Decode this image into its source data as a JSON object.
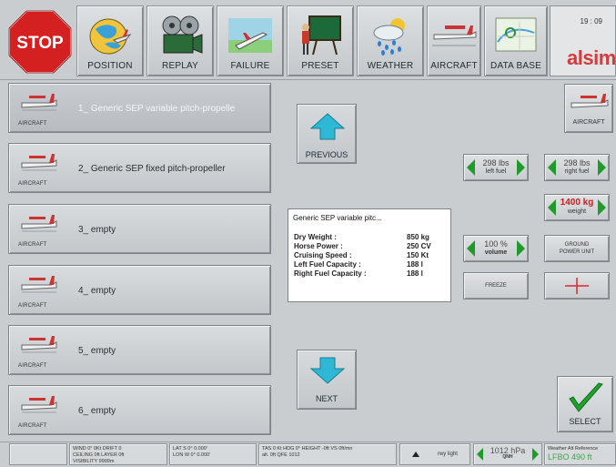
{
  "toolbar": {
    "stop_label": "STOP",
    "buttons": [
      {
        "label": "POSITION",
        "icon": "globe-plane-icon"
      },
      {
        "label": "REPLAY",
        "icon": "film-reel-icon"
      },
      {
        "label": "FAILURE",
        "icon": "crashed-plane-icon"
      },
      {
        "label": "PRESET",
        "icon": "chalkboard-instructor-icon"
      },
      {
        "label": "WEATHER",
        "icon": "rain-cloud-icon"
      },
      {
        "label": "AIRCRAFT",
        "icon": "aircraft-icon"
      },
      {
        "label": "DATA BASE",
        "icon": "map-database-icon"
      }
    ],
    "time": "19 : 09",
    "brand": "alsim"
  },
  "aircraft_list": [
    {
      "number": "1_",
      "name": "Generic SEP variable pitch-propelle",
      "sub": "AIRCRAFT",
      "selected": true
    },
    {
      "number": "2_",
      "name": "Generic SEP fixed pitch-propeller",
      "sub": "AIRCRAFT",
      "selected": false
    },
    {
      "number": "3_",
      "name": "empty",
      "sub": "AIRCRAFT",
      "selected": false
    },
    {
      "number": "4_",
      "name": "empty",
      "sub": "AIRCRAFT",
      "selected": false
    },
    {
      "number": "5_",
      "name": "empty",
      "sub": "AIRCRAFT",
      "selected": false
    },
    {
      "number": "6_",
      "name": "empty",
      "sub": "AIRCRAFT",
      "selected": false
    }
  ],
  "nav": {
    "previous": "PREVIOUS",
    "next": "NEXT"
  },
  "info": {
    "title": "Generic SEP variable pitc...",
    "rows": [
      {
        "label": "Dry Weight :",
        "value": "850 kg"
      },
      {
        "label": "Horse Power :",
        "value": "250 CV"
      },
      {
        "label": "Cruising Speed :",
        "value": "150 Kt"
      },
      {
        "label": "Left Fuel Capacity :",
        "value": "188 l"
      },
      {
        "label": "Right Fuel Capacity :",
        "value": "188 l"
      }
    ]
  },
  "right_panel": {
    "aircraft_label": "AIRCRAFT",
    "left_fuel": {
      "value": "298 lbs",
      "sub": "left fuel"
    },
    "right_fuel": {
      "value": "298 lbs",
      "sub": "right fuel"
    },
    "weight": {
      "value": "1400 kg",
      "sub": "weight"
    },
    "volume": {
      "value": "100 %",
      "sub": "volume"
    },
    "ground_power": "GROUND POWER UNIT",
    "freeze": "FREEZE",
    "select": "SELECT"
  },
  "status_bar": {
    "wind": [
      "WIND 0° 0Kt  DRIFT 0",
      "CEILING 0ft  LAYER 0ft",
      "VISIBILITY 9999m"
    ],
    "pos": [
      "LAT  S 0° 0.000'",
      "LON  W 0° 0.000'"
    ],
    "speeds": [
      "TAS 0 Kt  HDG 0°  HEIGHT -0ft  VS 0ft/mn",
      "alt. 0ft  QFE 1012"
    ],
    "rwy_light": "rwy light",
    "qnh": {
      "value": "1012 hPa",
      "sub": "QNH"
    },
    "weather_ref": [
      "Weather Alt Reference",
      "LFBO  490 ft"
    ]
  },
  "colors": {
    "accent_green": "#1f9a2b",
    "stop_red": "#d42020",
    "brand_red": "#d43b3b",
    "cyan_arrow": "#2fb8d6"
  }
}
